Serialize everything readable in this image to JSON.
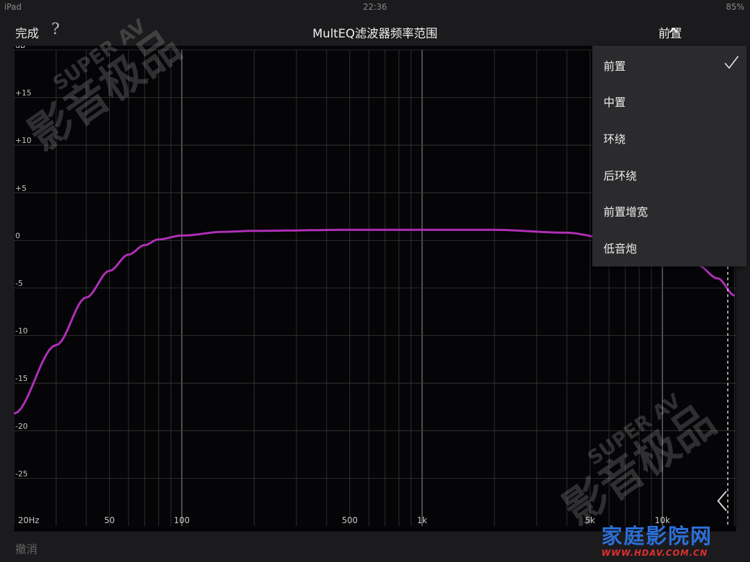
{
  "status_bar": {
    "carrier": "iPad",
    "time": "22:36",
    "battery": "85%"
  },
  "nav": {
    "done_label": "完成",
    "help_label": "?",
    "title": "MultEQ滤波器频率范围",
    "channel_selected": "前置"
  },
  "dropdown": {
    "items": [
      {
        "label": "前置",
        "checked": true
      },
      {
        "label": "中置",
        "checked": false
      },
      {
        "label": "环绕",
        "checked": false
      },
      {
        "label": "后环绕",
        "checked": false
      },
      {
        "label": "前置增宽",
        "checked": false
      },
      {
        "label": "低音炮",
        "checked": false
      }
    ]
  },
  "bottom": {
    "undo_label": "撤消"
  },
  "watermarks": {
    "main": "影音极品",
    "sub": "SUPER AV",
    "site": "家庭影院网",
    "url": "WWW.HDAV.COM.CN"
  },
  "colors": {
    "curve": "#b12fb8",
    "background": "#050507",
    "grid": "#3a3a3a",
    "site_logo": "#2c6fd9",
    "site_url": "#e03030"
  },
  "chart_data": {
    "type": "line",
    "xlabel": "",
    "ylabel": "dB",
    "x_scale": "log",
    "xlim": [
      20,
      20000
    ],
    "ylim": [
      -30,
      20
    ],
    "x_tick_labels": [
      {
        "value": 20,
        "label": "20Hz"
      },
      {
        "value": 50,
        "label": "50"
      },
      {
        "value": 100,
        "label": "100"
      },
      {
        "value": 500,
        "label": "500"
      },
      {
        "value": 1000,
        "label": "1k"
      },
      {
        "value": 5000,
        "label": "5k"
      },
      {
        "value": 10000,
        "label": "10k"
      }
    ],
    "y_tick_labels": [
      {
        "value": 20,
        "label": "dB"
      },
      {
        "value": 15,
        "label": "+15"
      },
      {
        "value": 10,
        "label": "+10"
      },
      {
        "value": 5,
        "label": "+5"
      },
      {
        "value": 0,
        "label": "0"
      },
      {
        "value": -5,
        "label": "-5"
      },
      {
        "value": -10,
        "label": "-10"
      },
      {
        "value": -15,
        "label": "-15"
      },
      {
        "value": -20,
        "label": "-20"
      },
      {
        "value": -25,
        "label": "-25"
      }
    ],
    "grid": true,
    "series": [
      {
        "values": [
          {
            "x": 20,
            "y": -18.2
          },
          {
            "x": 30,
            "y": -11.0
          },
          {
            "x": 40,
            "y": -6.0
          },
          {
            "x": 50,
            "y": -3.2
          },
          {
            "x": 60,
            "y": -1.5
          },
          {
            "x": 70,
            "y": -0.5
          },
          {
            "x": 80,
            "y": 0.1
          },
          {
            "x": 100,
            "y": 0.5
          },
          {
            "x": 150,
            "y": 0.9
          },
          {
            "x": 200,
            "y": 1.0
          },
          {
            "x": 500,
            "y": 1.1
          },
          {
            "x": 1000,
            "y": 1.1
          },
          {
            "x": 2000,
            "y": 1.1
          },
          {
            "x": 4000,
            "y": 0.8
          },
          {
            "x": 6000,
            "y": 0.2
          },
          {
            "x": 10000,
            "y": -1.2
          },
          {
            "x": 14000,
            "y": -2.6
          },
          {
            "x": 17000,
            "y": -4.0
          },
          {
            "x": 20000,
            "y": -5.8
          }
        ]
      }
    ],
    "cutoff_marker_x": 20000
  }
}
